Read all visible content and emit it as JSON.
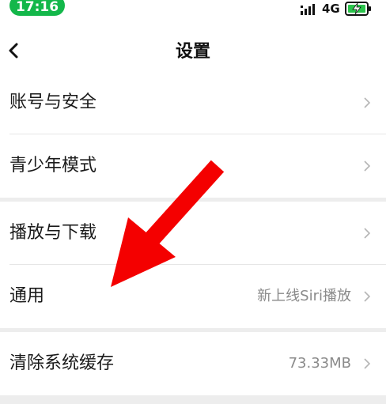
{
  "status_bar": {
    "time": "17:16",
    "network": "4G",
    "icons": [
      "signal-icon",
      "battery-charging-icon"
    ],
    "time_pill_color": "#13b74a"
  },
  "nav": {
    "title": "设置",
    "back_icon": "chevron-left-icon"
  },
  "groups": [
    {
      "items": [
        {
          "label": "账号与安全",
          "value": ""
        },
        {
          "label": "青少年模式",
          "value": ""
        }
      ]
    },
    {
      "items": [
        {
          "label": "播放与下载",
          "value": ""
        },
        {
          "label": "通用",
          "value": "新上线Siri播放"
        }
      ]
    },
    {
      "items": [
        {
          "label": "清除系统缓存",
          "value": "73.33MB"
        }
      ]
    }
  ],
  "annotation": {
    "icon": "red-arrow-icon",
    "color": "#f40000"
  }
}
